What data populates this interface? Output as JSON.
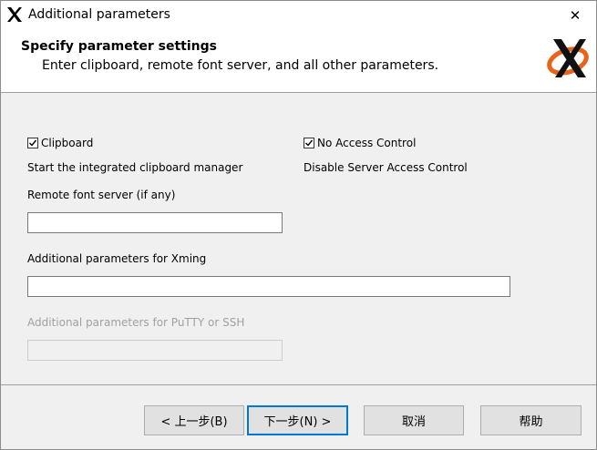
{
  "window": {
    "title": "Additional parameters",
    "close_glyph": "✕"
  },
  "header": {
    "title": "Specify parameter settings",
    "subtitle": "Enter clipboard, remote font server, and all other parameters."
  },
  "options": {
    "clipboard": {
      "label": "Clipboard",
      "checked": true,
      "description": "Start the integrated clipboard manager"
    },
    "no_access_control": {
      "label": "No Access Control",
      "checked": true,
      "description": "Disable Server Access Control"
    }
  },
  "fields": {
    "font_server": {
      "label": "Remote font server (if any)",
      "value": ""
    },
    "xming_params": {
      "label": "Additional parameters for Xming",
      "value": ""
    },
    "putty_params": {
      "label": "Additional parameters for PuTTY or SSH",
      "value": "",
      "disabled": true
    }
  },
  "buttons": {
    "back": "< 上一步(B)",
    "next": "下一步(N) >",
    "cancel": "取消",
    "help": "帮助"
  },
  "colors": {
    "accent": "#0078d7",
    "logo_orange": "#e8641b",
    "disabled_text": "#a0a0a0"
  },
  "icons": {
    "app": "xming-x-icon",
    "logo": "xming-logo-icon",
    "close": "close-icon",
    "check": "checkmark-icon"
  }
}
